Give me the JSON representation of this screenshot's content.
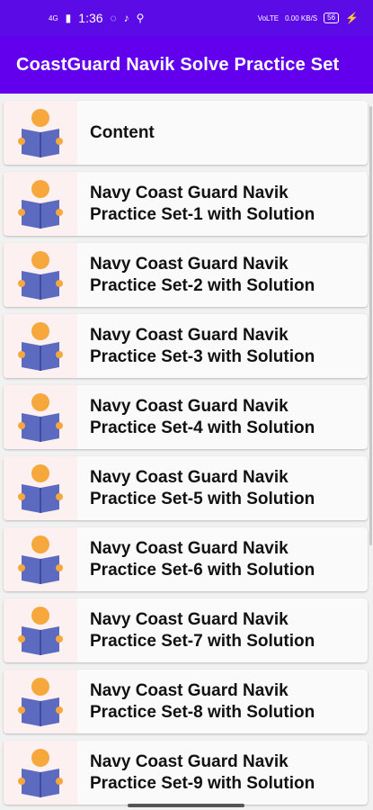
{
  "status_bar": {
    "network": "4G",
    "time": "1:36",
    "right_network": "VoLTE",
    "speed": "0.00 KB/S",
    "battery": "56"
  },
  "app_bar": {
    "title": "CoastGuard Navik Solve Practice Set"
  },
  "list": {
    "items": [
      {
        "label": "Content"
      },
      {
        "label": "Navy Coast Guard Navik\nPractice Set-1 with Solution"
      },
      {
        "label": "Navy Coast Guard Navik\nPractice Set-2 with Solution"
      },
      {
        "label": "Navy Coast Guard Navik\nPractice Set-3 with Solution"
      },
      {
        "label": "Navy Coast Guard Navik\nPractice Set-4 with Solution"
      },
      {
        "label": "Navy Coast Guard Navik\nPractice Set-5 with Solution"
      },
      {
        "label": "Navy Coast Guard Navik\nPractice Set-6 with Solution"
      },
      {
        "label": "Navy Coast Guard Navik\nPractice Set-7 with Solution"
      },
      {
        "label": "Navy Coast Guard Navik\nPractice Set-8 with Solution"
      },
      {
        "label": "Navy Coast Guard Navik\nPractice Set-9 with Solution"
      }
    ]
  },
  "colors": {
    "status_bar": "#5b0ce6",
    "app_bar": "#6200ee",
    "icon_head": "#f6a83c",
    "icon_book": "#5c6bc0"
  },
  "icons": {
    "list_item": "reading-person-icon"
  }
}
